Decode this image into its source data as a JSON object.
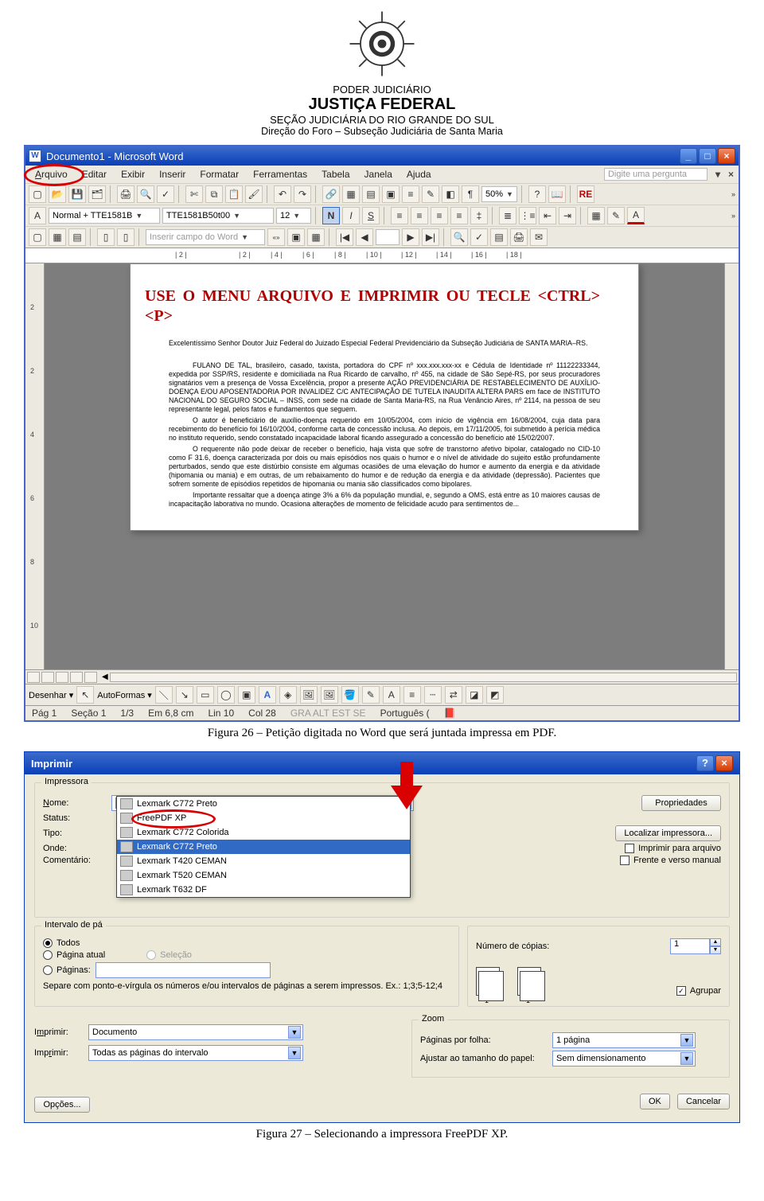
{
  "header": {
    "l1": "PODER JUDICIÁRIO",
    "l2": "JUSTIÇA FEDERAL",
    "l3": "SEÇÃO JUDICIÁRIA DO RIO GRANDE DO SUL",
    "l4": "Direção do Foro – Subseção Judiciária de Santa Maria"
  },
  "word": {
    "title": "Documento1 - Microsoft Word",
    "menu": [
      "Arquivo",
      "Editar",
      "Exibir",
      "Inserir",
      "Formatar",
      "Ferramentas",
      "Tabela",
      "Janela",
      "Ajuda"
    ],
    "ask": "Digite uma pergunta",
    "style": "Normal + TTE1581B",
    "font": "TTE1581B50t00",
    "size": "12",
    "zoom": "50%",
    "ruler_marks": [
      "| 2 |",
      "| 2 |",
      "| 4 |",
      "| 6 |",
      "| 8 |",
      "| 10 |",
      "| 12 |",
      "| 14 |",
      "| 16 |",
      "| 18 |"
    ],
    "banner": "USE O MENU ARQUIVO E IMPRIMIR OU TECLE <CTRL><P>",
    "mailmerge_label": "Inserir campo do Word",
    "draw_label": "Desenhar",
    "autoshapes_label": "AutoFormas",
    "body": {
      "p1": "Excelentíssimo Senhor Doutor Juiz Federal do Juizado Especial Federal Previdenciário da Subseção Judiciária de SANTA MARIA–RS.",
      "p2": "FULANO DE TAL, brasileiro, casado, taxista, portadora do CPF nº xxx.xxx.xxx-xx e Cédula de Identidade nº 11122233344, expedida por SSP/RS, residente e domiciliada na Rua Ricardo de carvalho, nº 455, na cidade de São Sepé-RS, por seus procuradores signatários vem a presença de Vossa Excelência, propor a presente AÇÃO PREVIDENCIÁRIA DE RESTABELECIMENTO DE AUXÍLIO-DOENÇA E/OU APOSENTADORIA POR INVALIDEZ C/C ANTECIPAÇÃO DE TUTELA INAUDITA ALTERA PARS em face de INSTITUTO NACIONAL DO SEGURO SOCIAL – INSS, com sede na cidade de Santa Maria-RS, na Rua Venâncio Aires, nº 2114, na pessoa de seu representante legal, pelos fatos e fundamentos que seguem.",
      "p3": "O autor é beneficiário de auxílio-doença requerido em 10/05/2004, com início de vigência em 16/08/2004, cuja data para recebimento do benefício foi 16/10/2004, conforme carta de concessão inclusa. Ao depois, em 17/11/2005, foi submetido à perícia médica no instituto requerido, sendo constatado incapacidade laboral ficando assegurado a concessão do benefício até 15/02/2007.",
      "p4": "O requerente não pode deixar de receber o benefício, haja vista que sofre de transtorno afetivo bipolar, catalogado no CID-10 como F 31.6, doença caracterizada por dois ou mais episódios nos quais o humor e o nível de atividade do sujeito estão profundamente perturbados, sendo que este distúrbio consiste em algumas ocasiões de uma elevação do humor e aumento da energia e da atividade (hipomania ou mania) e em outras, de um rebaixamento do humor e de redução da energia e da atividade (depressão). Pacientes que sofrem somente de episódios repetidos de hipomania ou mania são classificados como bipolares.",
      "p5": "Importante ressaltar que a doença atinge 3% a 6% da população mundial, e, segundo a OMS, está entre as 10 maiores causas de incapacitação laborativa no mundo. Ocasiona alterações de momento de felicidade acudo para sentimentos de..."
    },
    "status": {
      "pag": "Pág 1",
      "secao": "Seção 1",
      "pagina": "1/3",
      "em": "Em 6,8 cm",
      "lin": "Lin 10",
      "col": "Col 28",
      "modes": "GRA  ALT  EST  SE",
      "lang": "Português ("
    }
  },
  "figure26": "Figura 26 – Petição digitada no Word que será juntada impressa em PDF.",
  "print": {
    "title": "Imprimir",
    "grp_printer": "Impressora",
    "lbl_name": "Nome:",
    "lbl_status": "Status:",
    "lbl_type": "Tipo:",
    "lbl_where": "Onde:",
    "lbl_comment": "Comentário:",
    "selected_printer": "Lexmark C772 Preto",
    "printers": [
      "Lexmark C772 Preto",
      "FreePDF XP",
      "Lexmark C772 Colorida",
      "Lexmark C772 Preto",
      "Lexmark T420 CEMAN",
      "Lexmark T520 CEMAN",
      "Lexmark T632 DF"
    ],
    "btn_props": "Propriedades",
    "btn_find": "Localizar impressora...",
    "chk_printfile": "Imprimir para arquivo",
    "chk_duplex": "Frente e verso manual",
    "grp_range": "Intervalo de pá",
    "rdo_all": "Todos",
    "rdo_current": "Página atual",
    "rdo_sel": "Seleção",
    "rdo_pages": "Páginas:",
    "range_help": "Separe com ponto-e-vírgula os números e/ou intervalos de páginas a serem impressos. Ex.: 1;3;5-12;4",
    "grp_copies_lbl": "Número de cópias:",
    "copies_value": "1",
    "chk_collate": "Agrupar",
    "lbl_print1": "Imprimir:",
    "val_print1": "Documento",
    "lbl_print2": "Imprimir:",
    "val_print2": "Todas as páginas do intervalo",
    "grp_zoom": "Zoom",
    "lbl_ppsheet": "Páginas por folha:",
    "val_ppsheet": "1 página",
    "lbl_scale": "Ajustar ao tamanho do papel:",
    "val_scale": "Sem dimensionamento",
    "btn_options": "Opções...",
    "btn_ok": "OK",
    "btn_cancel": "Cancelar"
  },
  "figure27": "Figura 27 – Selecionando a impressora FreePDF XP."
}
